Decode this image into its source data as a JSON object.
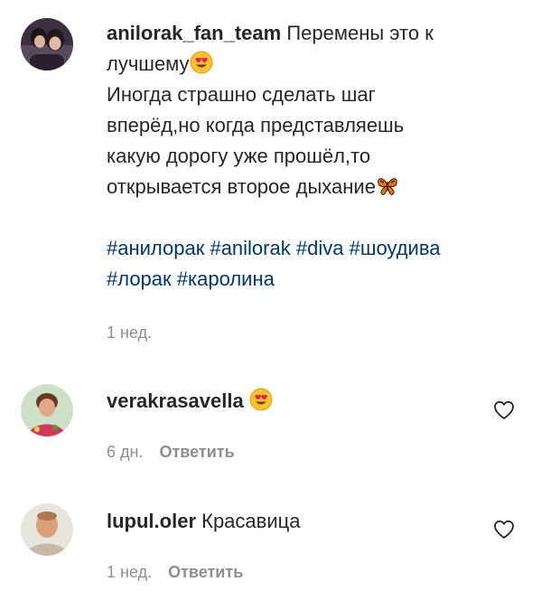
{
  "post": {
    "username": "anilorak_fan_team",
    "caption_lines": [
      "Перемены это к",
      "лучшему",
      "Иногда страшно сделать шаг",
      "вперёд,но когда представляешь",
      "какую дорогу уже прошёл,то",
      "открывается второе дыхание"
    ],
    "hashtags_line1": [
      "#анилорак",
      "#anilorak",
      "#diva",
      "#шоудива"
    ],
    "hashtags_line2": [
      "#лорак",
      "#каролина"
    ],
    "time": "1 нед.",
    "emojis": [
      "heart-eyes-emoji",
      "butterfly-emoji"
    ]
  },
  "comments": [
    {
      "username": "verakrasavella",
      "text": "",
      "emoji": "heart-eyes-emoji",
      "time": "6 дн.",
      "reply_label": "Ответить",
      "like_icon": "heart-outline-icon"
    },
    {
      "username": "lupul.oler",
      "text": "Красавица",
      "time": "1 нед.",
      "reply_label": "Ответить",
      "like_icon": "heart-outline-icon"
    }
  ],
  "colors": {
    "text": "#262626",
    "secondary": "#8e8e8e",
    "hashtag": "#00376b"
  }
}
